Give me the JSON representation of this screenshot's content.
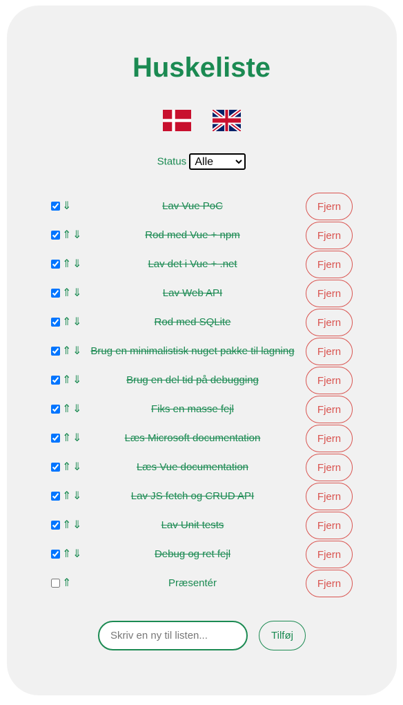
{
  "app": {
    "title": "Huskeliste",
    "accent_color": "#1b8a52",
    "danger_color": "#d9534f"
  },
  "languages": [
    {
      "code": "da",
      "icon": "danish-flag-icon"
    },
    {
      "code": "en",
      "icon": "uk-flag-icon"
    }
  ],
  "filter": {
    "label": "Status",
    "selected": "Alle",
    "options": [
      "Alle"
    ]
  },
  "todos": [
    {
      "text": "Lav Vue PoC",
      "done": true,
      "up": false,
      "down": true
    },
    {
      "text": "Rod med Vue + npm",
      "done": true,
      "up": true,
      "down": true
    },
    {
      "text": "Lav det i Vue + .net",
      "done": true,
      "up": true,
      "down": true
    },
    {
      "text": "Lav Web API",
      "done": true,
      "up": true,
      "down": true
    },
    {
      "text": "Rod med SQLite",
      "done": true,
      "up": true,
      "down": true
    },
    {
      "text": "Brug en minimalistisk nuget pakke til lagning",
      "done": true,
      "up": true,
      "down": true
    },
    {
      "text": "Brug en del tid på debugging",
      "done": true,
      "up": true,
      "down": true
    },
    {
      "text": "Fiks en masse fejl",
      "done": true,
      "up": true,
      "down": true
    },
    {
      "text": "Læs Microsoft documentation",
      "done": true,
      "up": true,
      "down": true
    },
    {
      "text": "Læs Vue documentation",
      "done": true,
      "up": true,
      "down": true
    },
    {
      "text": "Lav JS fetch og CRUD API",
      "done": true,
      "up": true,
      "down": true
    },
    {
      "text": "Lav Unit tests",
      "done": true,
      "up": true,
      "down": true
    },
    {
      "text": "Debug og ret fejl",
      "done": true,
      "up": true,
      "down": true
    },
    {
      "text": "Præsentér",
      "done": false,
      "up": true,
      "down": false
    }
  ],
  "remove_label": "Fjern",
  "arrows": {
    "up": "⇑",
    "down": "⇓"
  },
  "new_item": {
    "placeholder": "Skriv en ny til listen...",
    "value": "",
    "add_label": "Tilføj"
  }
}
